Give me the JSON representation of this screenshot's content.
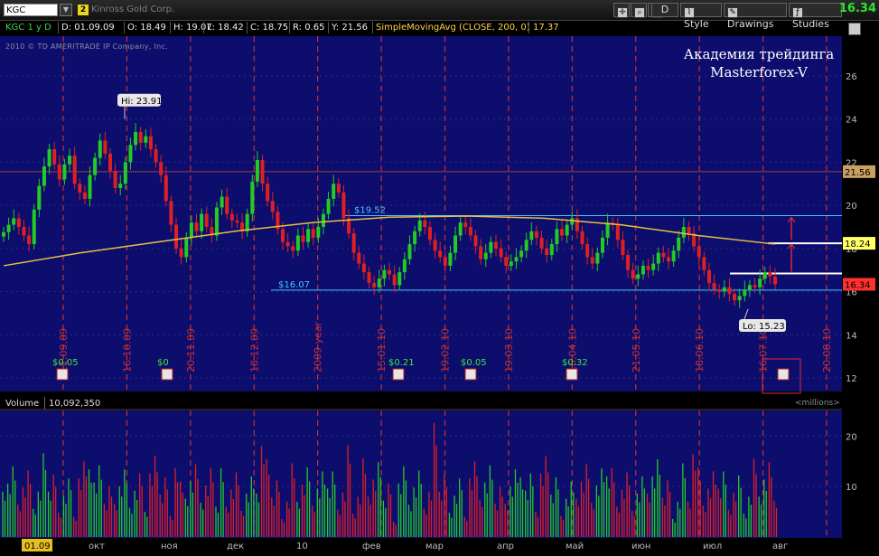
{
  "toolbar": {
    "symbol": "KGC",
    "link_number": "2",
    "company": "Kinross Gold Corp.",
    "period_button": "D",
    "style_label": "Style",
    "drawings_label": "Drawings",
    "studies_label": "Studies",
    "last_price": "16.34"
  },
  "infobar": {
    "symbol_period": "KGC 1 y D",
    "date": "D: 01.09.09",
    "open": "O: 18.49",
    "high": "H: 19.07",
    "low": "L: 18.42",
    "close": "C: 18.75",
    "range": "R: 0.65",
    "y": "Y: 21.56",
    "study": "SimpleMovingAvg (CLOSE, 200, 0)",
    "study_value": "17.37"
  },
  "copyright": "2010 © TD AMERITRADE IP Company, Inc.",
  "watermark": [
    "Академия трейдинга",
    "Masterforex-V"
  ],
  "colors": {
    "background": "#0d0d6e",
    "up": "#22cc22",
    "down": "#e02020",
    "sma": "#e8c040",
    "hline": "#40c8ff",
    "grid": "#c83030",
    "axis_bg": "#000000"
  },
  "chart_data": {
    "type": "candlestick",
    "ylim": [
      11.5,
      27
    ],
    "y_ticks": [
      12,
      14,
      16,
      18,
      20,
      22,
      24,
      26
    ],
    "price_labels": [
      {
        "value": 21.56,
        "label": "21.56",
        "color": "#c8a060"
      },
      {
        "value": 18.24,
        "label": "18.24",
        "color": "#ffff66"
      },
      {
        "value": 16.34,
        "label": "16.34",
        "color": "#ff3030"
      }
    ],
    "hi": {
      "label": "Hi: 23.91",
      "value": 23.91
    },
    "lo": {
      "label": "Lo: 15.23",
      "value": 15.23
    },
    "levels": [
      {
        "value": 19.52,
        "label": "$19.52"
      },
      {
        "value": 16.07,
        "label": "$16.07"
      }
    ],
    "x_month_labels": [
      "окт",
      "ноя",
      "дек",
      "10",
      "фев",
      "мар",
      "апр",
      "май",
      "июн",
      "июл",
      "авг"
    ],
    "start_date_label": "01.09",
    "vertical_date_labels": [
      "11.09.09",
      "16.10.09",
      "20.11.09",
      "18.12.09",
      "2009 year",
      "15.01.10",
      "19.02.10",
      "19.03.10",
      "16.04.10",
      "21.05.10",
      "18.06.10",
      "16.07.10",
      "20.08.10"
    ],
    "dividends": [
      "$0.05",
      "$0",
      "$0.21",
      "$0.05",
      "$0.32"
    ],
    "closes": [
      18.75,
      19.1,
      19.4,
      19.0,
      18.6,
      18.2,
      19.8,
      20.9,
      21.8,
      22.6,
      21.9,
      21.2,
      21.9,
      22.3,
      21.0,
      20.6,
      20.3,
      21.4,
      22.2,
      23.0,
      22.4,
      21.6,
      20.8,
      21.0,
      22.0,
      22.8,
      23.4,
      22.9,
      23.2,
      22.6,
      22.0,
      21.4,
      20.2,
      19.1,
      18.0,
      17.6,
      18.5,
      19.2,
      18.8,
      19.6,
      19.0,
      18.6,
      19.9,
      20.4,
      19.6,
      19.3,
      19.2,
      18.8,
      19.6,
      21.1,
      22.1,
      21.0,
      20.2,
      19.7,
      18.9,
      18.3,
      18.1,
      17.9,
      18.6,
      18.3,
      18.9,
      18.5,
      19.0,
      19.6,
      20.3,
      21.0,
      20.6,
      19.4,
      18.7,
      17.8,
      17.3,
      16.9,
      16.4,
      16.2,
      16.6,
      17.0,
      16.8,
      16.3,
      16.9,
      17.5,
      18.2,
      18.8,
      19.3,
      19.0,
      18.4,
      17.9,
      17.6,
      17.2,
      17.8,
      18.6,
      19.2,
      19.0,
      18.6,
      18.1,
      17.5,
      17.8,
      18.3,
      18.0,
      17.6,
      17.2,
      17.4,
      17.6,
      17.9,
      18.4,
      18.8,
      18.5,
      18.0,
      17.7,
      18.2,
      18.9,
      18.6,
      19.1,
      19.4,
      18.8,
      18.2,
      17.6,
      17.3,
      17.8,
      18.5,
      19.2,
      19.1,
      18.4,
      17.7,
      17.0,
      16.6,
      16.8,
      17.2,
      17.0,
      17.3,
      17.8,
      17.6,
      17.4,
      17.9,
      18.5,
      19.0,
      18.7,
      18.1,
      17.6,
      17.0,
      16.4,
      16.1,
      16.0,
      16.2,
      15.9,
      15.6,
      15.8,
      16.1,
      16.3,
      16.2,
      16.6,
      16.9,
      16.7,
      16.34
    ],
    "sma_points": [
      [
        0.0,
        17.2
      ],
      [
        0.1,
        17.8
      ],
      [
        0.2,
        18.3
      ],
      [
        0.3,
        18.8
      ],
      [
        0.4,
        19.2
      ],
      [
        0.5,
        19.45
      ],
      [
        0.6,
        19.5
      ],
      [
        0.7,
        19.4
      ],
      [
        0.8,
        19.1
      ],
      [
        0.9,
        18.6
      ],
      [
        1.0,
        18.2
      ]
    ],
    "volume": {
      "label": "Volume",
      "value": "10,092,350",
      "unit": "<millions>",
      "ylim": [
        0,
        24
      ],
      "y_ticks": [
        10,
        20
      ]
    }
  }
}
